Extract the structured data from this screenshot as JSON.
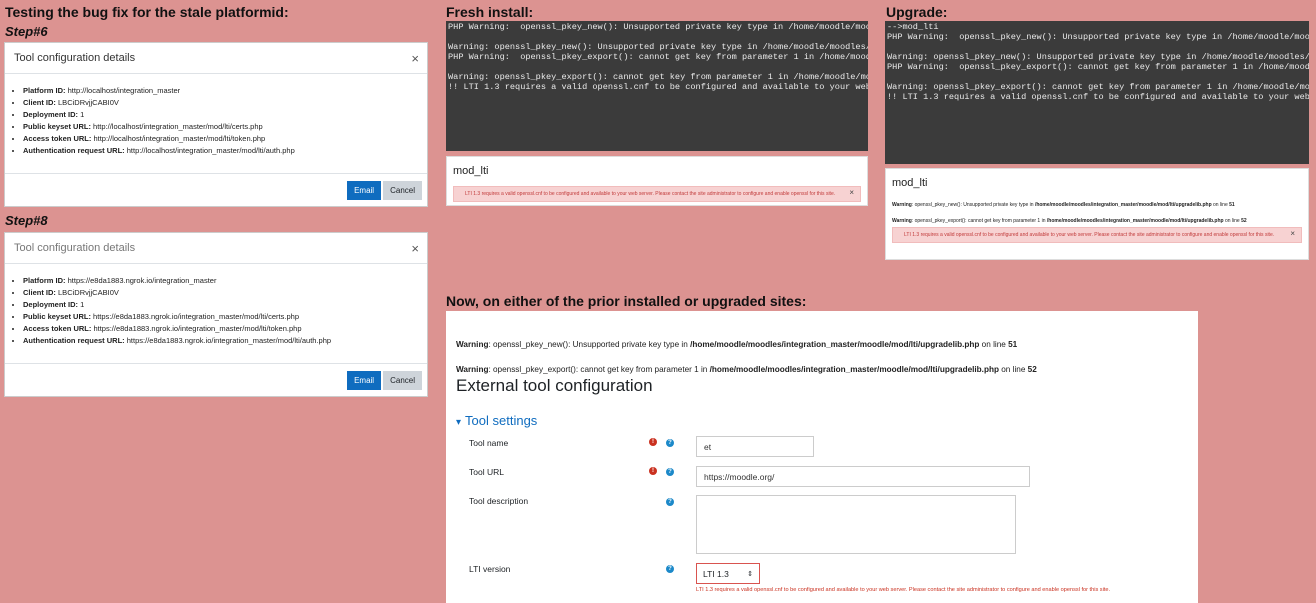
{
  "headings": {
    "left": "Testing the bug fix for the stale platformid:",
    "fresh": "Fresh install:",
    "upgrade": "Upgrade:",
    "now": "Now, on either of the prior installed or upgraded sites:"
  },
  "step6": {
    "label": "Step#6",
    "modal": {
      "title": "Tool configuration details",
      "close": "×",
      "items": [
        {
          "key": "Platform ID:",
          "value": "http://localhost/integration_master"
        },
        {
          "key": "Client ID:",
          "value": "LBCiDRvjjCABI0V"
        },
        {
          "key": "Deployment ID:",
          "value": "1"
        },
        {
          "key": "Public keyset URL:",
          "value": "http://localhost/integration_master/mod/lti/certs.php"
        },
        {
          "key": "Access token URL:",
          "value": "http://localhost/integration_master/mod/lti/token.php"
        },
        {
          "key": "Authentication request URL:",
          "value": "http://localhost/integration_master/mod/lti/auth.php"
        }
      ],
      "email": "Email",
      "cancel": "Cancel"
    }
  },
  "step8": {
    "label": "Step#8",
    "modal": {
      "title": "Tool configuration details",
      "close": "×",
      "items": [
        {
          "key": "Platform ID:",
          "value": "https://e8da1883.ngrok.io/integration_master"
        },
        {
          "key": "Client ID:",
          "value": "LBCiDRvjjCABI0V"
        },
        {
          "key": "Deployment ID:",
          "value": "1"
        },
        {
          "key": "Public keyset URL:",
          "value": "https://e8da1883.ngrok.io/integration_master/mod/lti/certs.php"
        },
        {
          "key": "Access token URL:",
          "value": "https://e8da1883.ngrok.io/integration_master/mod/lti/token.php"
        },
        {
          "key": "Authentication request URL:",
          "value": "https://e8da1883.ngrok.io/integration_master/mod/lti/auth.php"
        }
      ],
      "email": "Email",
      "cancel": "Cancel"
    }
  },
  "fresh": {
    "terminal": "PHP Warning:  openssl_pkey_new(): Unsupported private key type in /home/moodle/moodles/integration_master/moodle/mod/lti/upgradelib.php on line 51\n\nWarning: openssl_pkey_new(): Unsupported private key type in /home/moodle/moodles/integration_master/moodle/mod/lti/upgradelib.php on line 51\nPHP Warning:  openssl_pkey_export(): cannot get key from parameter 1 in /home/moodle/moodles/integration_master/moodle/mod/lti/upgradelib.php on line 52\n\nWarning: openssl_pkey_export(): cannot get key from parameter 1 in /home/moodle/moodles/integration_master/moodle/mod/lti/upgradelib.php on line 52\n!! LTI 1.3 requires a valid openssl.cnf to be configured and available to your web server. Please contact the site administrator to configure and enable openssl for this site. !!",
    "panel_title": "mod_lti",
    "alert": "LTI 1.3 requires a valid openssl.cnf to be configured and available to your web server. Please contact the site administrator to configure and enable openssl for this site.",
    "alert_close": "×"
  },
  "upgrade": {
    "terminal": "-->mod_lti\nPHP Warning:  openssl_pkey_new(): Unsupported private key type in /home/moodle/moodles/integration_master/moodle/mod/lti/upgradelib.php on line 51\n\nWarning: openssl_pkey_new(): Unsupported private key type in /home/moodle/moodles/integration_master/moodle/mod/lti/upgradelib.php on line 51\nPHP Warning:  openssl_pkey_export(): cannot get key from parameter 1 in /home/moodle/moodles/integration_master/moodle/mod/lti/upgradelib.php on line 52\n\nWarning: openssl_pkey_export(): cannot get key from parameter 1 in /home/moodle/moodles/integration_master/moodle/mod/lti/upgradelib.php on line 52\n!! LTI 1.3 requires a valid openssl.cnf to be configured and available to your web server. Please contact the site administrator to configure and enable openssl for this site. !!",
    "panel_title": "mod_lti",
    "warn1_label": "Warning",
    "warn1_text": ": openssl_pkey_new(): Unsupported private key type in ",
    "warn1_path": "/home/moodle/moodles/integration_master/moodle/mod/lti/upgradelib.php",
    "warn1_line": " on line ",
    "warn1_num": "51",
    "warn2_label": "Warning",
    "warn2_text": ": openssl_pkey_export(): cannot get key from parameter 1 in ",
    "warn2_path": "/home/moodle/moodles/integration_master/moodle/mod/lti/upgradelib.php",
    "warn2_line": " on line ",
    "warn2_num": "52",
    "alert": "LTI 1.3 requires a valid openssl.cnf to be configured and available to your web server. Please contact the site administrator to configure and enable openssl for this site.",
    "alert_close": "×"
  },
  "config": {
    "warn1_label": "Warning",
    "warn1_text": ": openssl_pkey_new(): Unsupported private key type in ",
    "warn1_path": "/home/moodle/moodles/integration_master/moodle/mod/lti/upgradelib.php",
    "warn1_line": " on line ",
    "warn1_num": "51",
    "warn2_label": "Warning",
    "warn2_text": ": openssl_pkey_export(): cannot get key from parameter 1 in ",
    "warn2_path": "/home/moodle/moodles/integration_master/moodle/mod/lti/upgradelib.php",
    "warn2_line": " on line ",
    "warn2_num": "52",
    "title": "External tool configuration",
    "section": "Tool settings",
    "section_toggle": "▾",
    "tool_name_label": "Tool name",
    "tool_name_value": "et",
    "tool_url_label": "Tool URL",
    "tool_url_value": "https://moodle.org/",
    "tool_desc_label": "Tool description",
    "tool_desc_value": "",
    "lti_version_label": "LTI version",
    "lti_version_value": "LTI 1.3",
    "lti_version_arrow": "⇕",
    "required_icon": "!",
    "help_icon": "?",
    "lti_error": "LTI 1.3 requires a valid openssl.cnf to be configured and available to your web server. Please contact the site administrator to configure and enable openssl for this site."
  }
}
